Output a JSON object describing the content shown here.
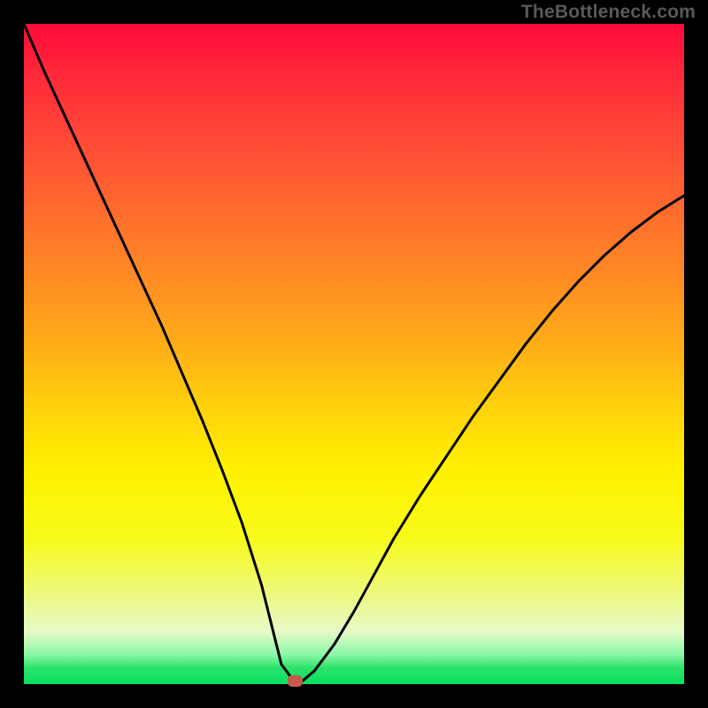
{
  "attribution": "TheBottleneck.com",
  "colors": {
    "frame": "#000000",
    "curve": "#000000",
    "marker": "#c55a4a",
    "gradient_top": "#ff0a3a",
    "gradient_bottom": "#06e060"
  },
  "chart_data": {
    "type": "line",
    "title": "",
    "xlabel": "",
    "ylabel": "",
    "xlim": [
      0,
      100
    ],
    "ylim": [
      0,
      100
    ],
    "notes": "V-shaped bottleneck curve on a red-to-green vertical gradient. Minimum (optimal point) is near x≈40. Left branch starts at the top-left corner; right branch rises to ~75% height at the right edge. A small rounded marker sits at the trough.",
    "series": [
      {
        "name": "bottleneck-curve",
        "x": [
          0,
          3,
          6,
          9,
          12,
          15,
          18,
          21,
          24,
          27,
          30,
          33,
          36,
          37.5,
          39,
          41,
          42,
          44,
          47,
          50,
          53,
          56,
          60,
          64,
          68,
          72,
          76,
          80,
          84,
          88,
          92,
          96,
          100
        ],
        "values": [
          100,
          93,
          86.5,
          80,
          73.5,
          67,
          60.5,
          54,
          47,
          40,
          32.5,
          24.5,
          15,
          9,
          3,
          0.3,
          0.3,
          2,
          6,
          11,
          16.5,
          22,
          28.5,
          34.5,
          40.5,
          46,
          51.5,
          56.5,
          61,
          65,
          68.5,
          71.5,
          74
        ]
      }
    ],
    "marker": {
      "x": 41,
      "y": 0.3
    },
    "flat_segment": {
      "x_start": 37.5,
      "x_end": 41,
      "y": 0.3
    }
  }
}
